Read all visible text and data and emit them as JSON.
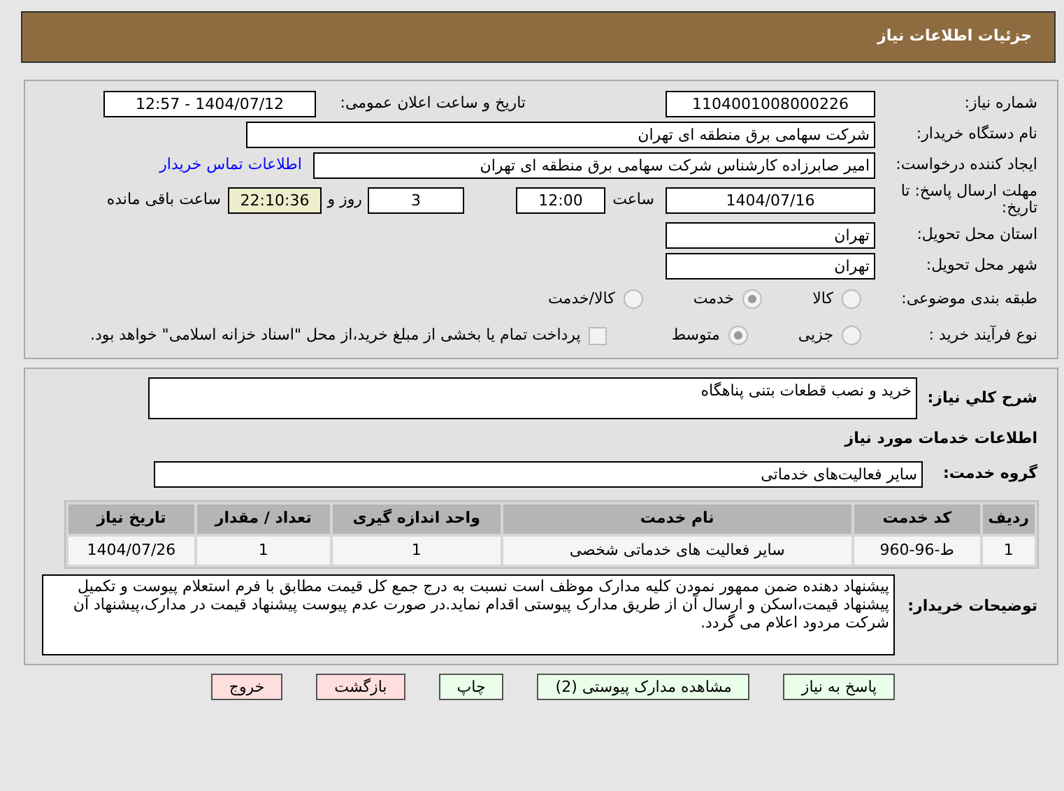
{
  "header": {
    "title": "جزئیات اطلاعات نیاز"
  },
  "details": {
    "need_number_label": "شماره نیاز:",
    "need_number": "1104001008000226",
    "announce_label": "تاریخ و ساعت اعلان عمومی:",
    "announce_value": "1404/07/12 - 12:57",
    "buyer_label": "نام دستگاه خریدار:",
    "buyer": "شرکت سهامی برق منطقه ای تهران",
    "creator_label": "ایجاد کننده درخواست:",
    "creator": "امیر صابرزاده کارشناس شرکت سهامی برق منطقه ای تهران",
    "contact_link": "اطلاعات تماس خریدار",
    "deadline_label": "مهلت ارسال پاسخ: تا تاریخ:",
    "deadline_date": "1404/07/16",
    "time_label": "ساعت",
    "deadline_time": "12:00",
    "days": "3",
    "days_label": "روز و",
    "remaining": "22:10:36",
    "remaining_label": "ساعت باقی مانده",
    "province_label": "استان محل تحویل:",
    "province": "تهران",
    "city_label": "شهر محل تحویل:",
    "city": "تهران",
    "category_label": "طبقه بندی موضوعی:",
    "category_options": [
      {
        "label": "کالا",
        "selected": false
      },
      {
        "label": "خدمت",
        "selected": true
      },
      {
        "label": "کالا/خدمت",
        "selected": false
      }
    ],
    "process_label": "نوع فرآیند خرید :",
    "process_options": [
      {
        "label": "جزیی",
        "selected": false
      },
      {
        "label": "متوسط",
        "selected": true
      }
    ],
    "treasury": {
      "label": "پرداخت تمام یا بخشی از مبلغ خرید،از محل \"اسناد خزانه اسلامی\" خواهد بود.",
      "checked": false
    }
  },
  "services": {
    "summary_label": "شرح کلي نياز:",
    "summary": "خرید و نصب قطعات بتنی پناهگاه",
    "section_title": "اطلاعات خدمات مورد نیاز",
    "group_label": "گروه خدمت:",
    "group": "سایر فعالیت‌های خدماتی",
    "table": {
      "columns": [
        "ردیف",
        "کد خدمت",
        "نام خدمت",
        "واحد اندازه گیری",
        "تعداد / مقدار",
        "تاریخ نیاز"
      ],
      "rows": [
        [
          "1",
          "ط-96-960",
          "سایر فعالیت های خدماتی شخصی",
          "1",
          "1",
          "1404/07/26"
        ]
      ]
    },
    "notes_label": "توضیحات خریدار:",
    "notes": "پیشنهاد دهنده ضمن ممهور نمودن کلیه مدارک موظف است نسبت به درج جمع کل قیمت مطابق با فرم استعلام پیوست و تکمیل پیشنهاد قیمت،اسکن و ارسال آن از طریق مدارک پیوستی اقدام نماید.در صورت عدم پیوست پیشنهاد قیمت در مدارک،پیشنهاد آن شرکت مردود اعلام می گردد."
  },
  "buttons": [
    {
      "label": "پاسخ به نیاز",
      "kind": "normal"
    },
    {
      "label": "مشاهده مدارک پیوستی (2)",
      "kind": "normal"
    },
    {
      "label": "چاپ",
      "kind": "normal"
    },
    {
      "label": "بازگشت",
      "kind": "danger"
    },
    {
      "label": "خروج",
      "kind": "danger"
    }
  ]
}
